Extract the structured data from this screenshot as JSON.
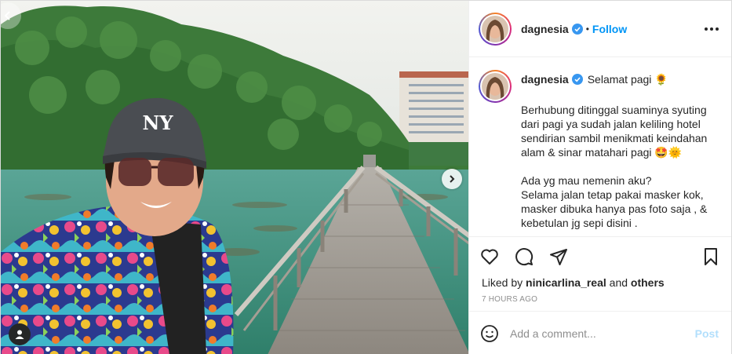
{
  "photo": {
    "cap_logo": "NY",
    "icons": {
      "prev": "chevron-left-icon",
      "next": "chevron-right-icon",
      "tagged_user": "user-icon"
    }
  },
  "header": {
    "username": "dagnesia",
    "separator": "•",
    "follow_label": "Follow",
    "icons": {
      "verified": "verified-badge-icon",
      "more": "more-options-icon"
    }
  },
  "caption": {
    "username": "dagnesia",
    "greeting": "Selamat pagi 🌻",
    "paragraphs": [
      "Berhubung ditinggal suaminya syuting dari pagi ya sudah jalan keliling hotel sendirian sambil menikmati keindahan alam & sinar matahari pagi 🤩🌞",
      "Ada yg mau nemenin aku?\nSelama jalan tetap pakai masker kok, masker dibuka hanya pas foto saja , & kebetulan jg sepi disini ."
    ]
  },
  "actions": {
    "icons": [
      "heart-icon",
      "comment-icon",
      "share-icon",
      "bookmark-icon"
    ]
  },
  "likes": {
    "prefix": "Liked by",
    "user": "ninicarlina_real",
    "connector": "and",
    "others": "others"
  },
  "timestamp": "7 HOURS AGO",
  "add_comment": {
    "placeholder": "Add a comment...",
    "post_label": "Post",
    "icons": {
      "emoji": "emoji-icon"
    }
  },
  "colors": {
    "accent": "#0095f6",
    "post_disabled": "#b2dffc",
    "meta": "#8e8e8e"
  }
}
